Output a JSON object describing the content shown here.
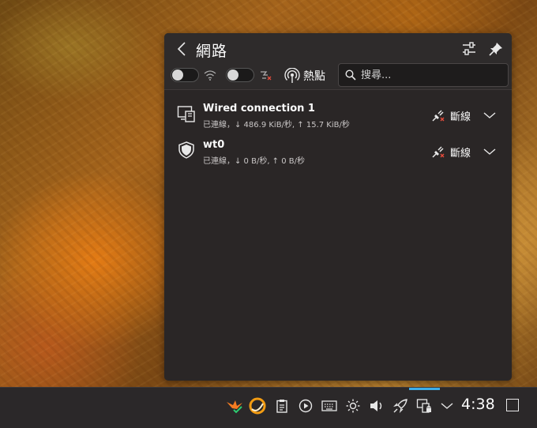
{
  "popup": {
    "title": "網路",
    "hotspot_label": "熱點",
    "search_placeholder": "搜尋...",
    "wifi_enabled": false,
    "airplane_enabled": false
  },
  "connections": [
    {
      "name": "Wired connection 1",
      "status": "已連線，↓ 486.9 KiB/秒, ↑ 15.7 KiB/秒",
      "action_label": "斷線",
      "icon": "wired-network-icon"
    },
    {
      "name": "wt0",
      "status": "已連線，↓ 0 B/秒, ↑ 0 B/秒",
      "action_label": "斷線",
      "icon": "vpn-shield-icon"
    }
  ],
  "taskbar": {
    "clock": "4:38"
  },
  "colors": {
    "accent": "#3daee9",
    "popup_bg": "#2a2626",
    "taskbar_bg": "#2b2829",
    "wifi_badge_green": "#2ecc71",
    "disconnect_x_red": "#e74c3c"
  }
}
